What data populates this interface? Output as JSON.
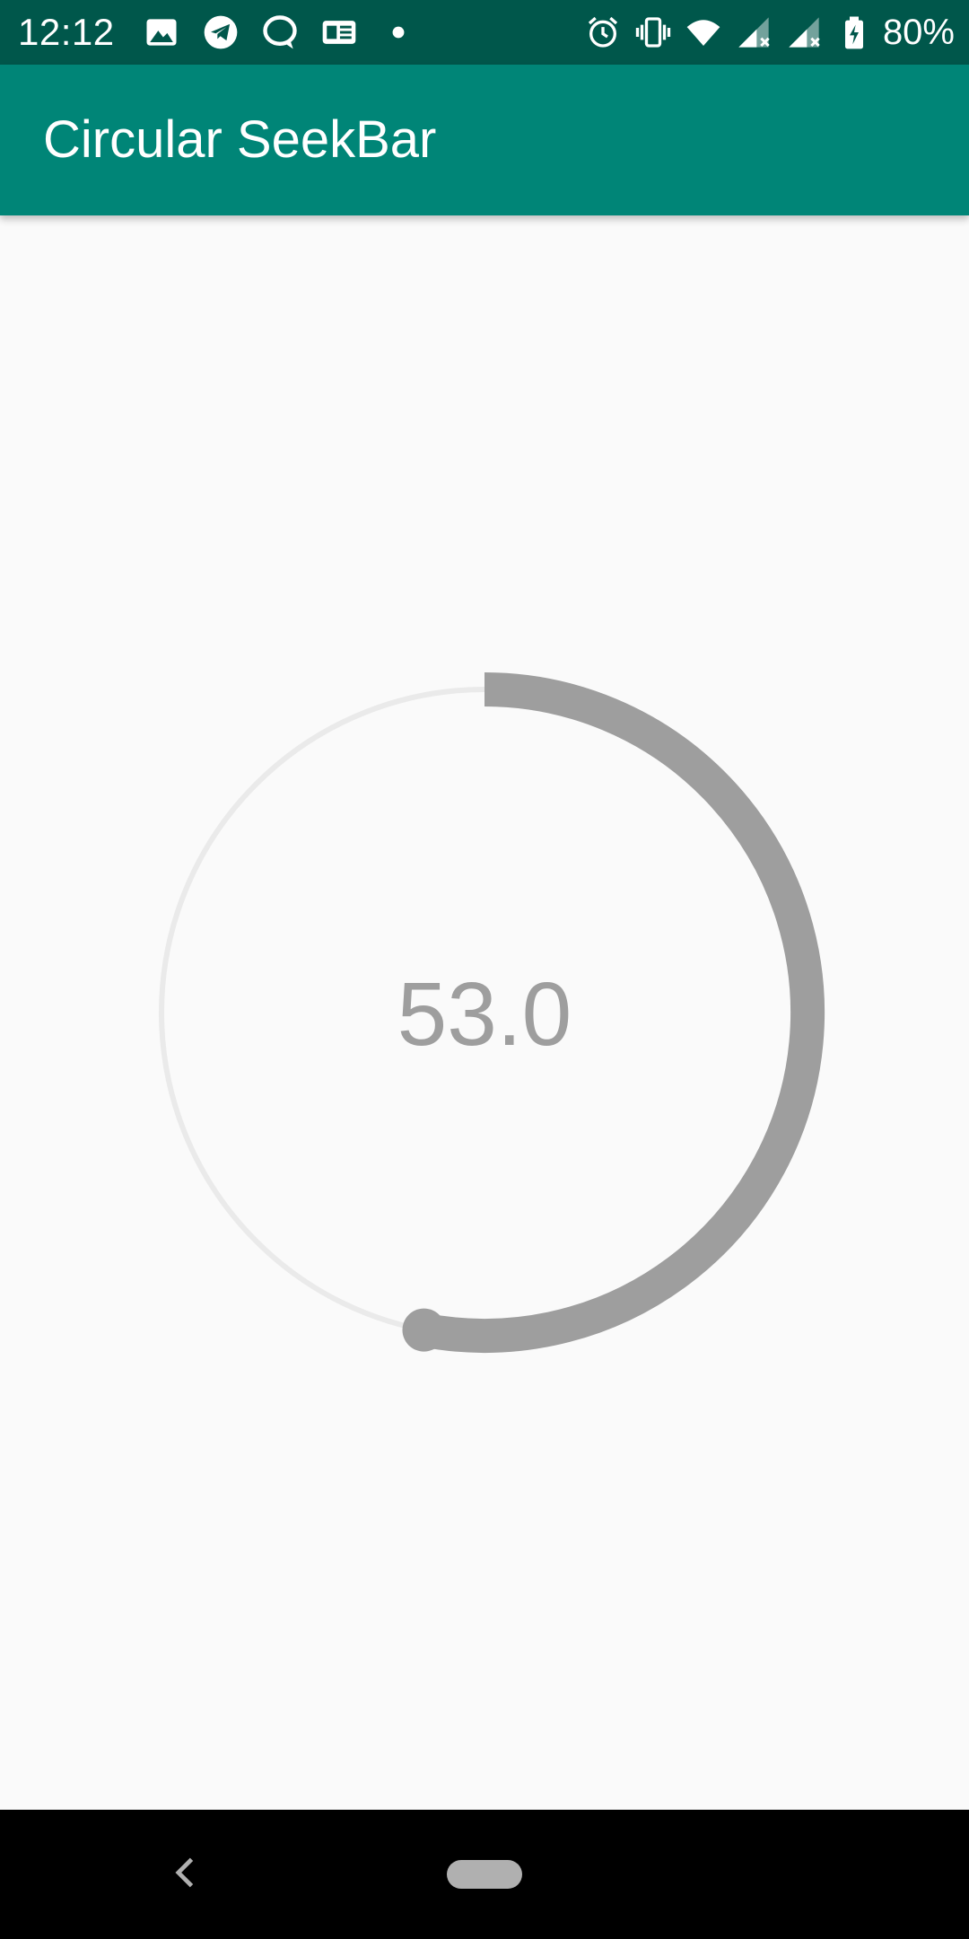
{
  "status_bar": {
    "time": "12:12",
    "battery_percent": "80%",
    "left_icons": [
      "image-icon",
      "telegram-icon",
      "chat-bubble-icon",
      "news-icon",
      "dot-icon"
    ],
    "right_icons": [
      "alarm-icon",
      "vibrate-icon",
      "wifi-icon",
      "signal-icon",
      "signal-icon",
      "battery-charging-icon"
    ]
  },
  "app_bar": {
    "title": "Circular SeekBar"
  },
  "seekbar": {
    "value": 53.0,
    "max": 100,
    "display_value": "53.0",
    "progress_color": "#9e9e9e",
    "track_color": "#eaeaea"
  },
  "colors": {
    "status_bar": "#00574b",
    "app_bar": "#008577",
    "background": "#fafafa",
    "nav_bar": "#000000"
  },
  "nav_bar": {
    "icons": [
      "back-icon",
      "home-pill-icon"
    ]
  }
}
